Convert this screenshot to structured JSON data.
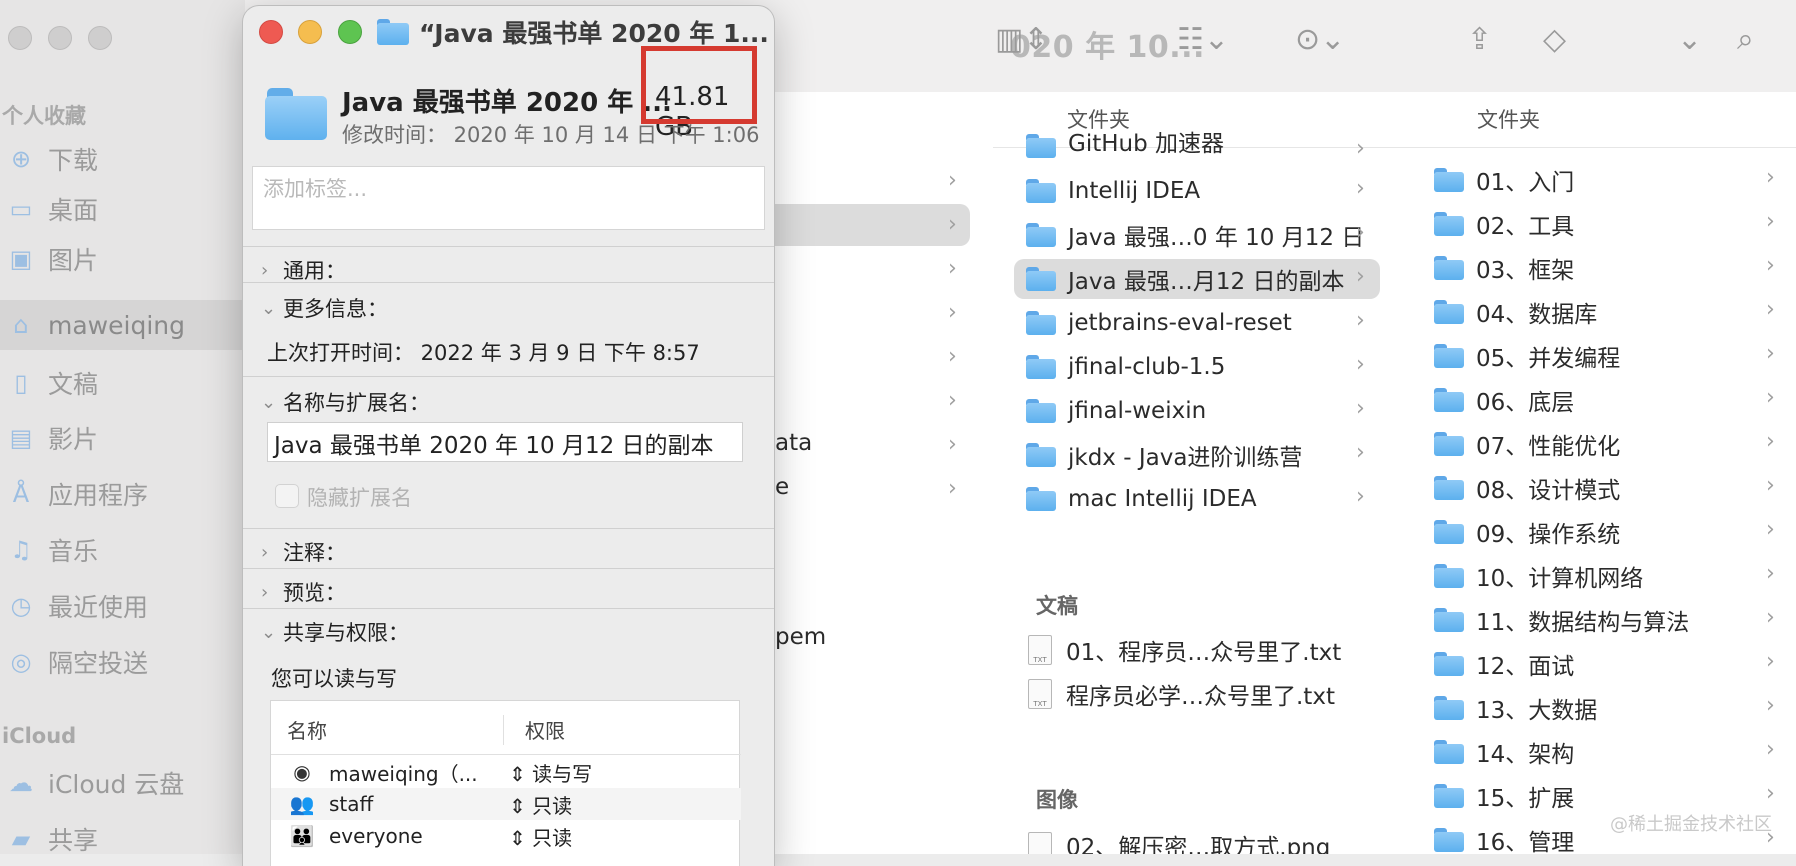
{
  "finder": {
    "window_title": "020 年 10...",
    "sidebar": {
      "favorites_label": "个人收藏",
      "items": [
        {
          "label": "下载",
          "icon": "download-icon"
        },
        {
          "label": "桌面",
          "icon": "desktop-icon"
        },
        {
          "label": "图片",
          "icon": "pictures-icon"
        },
        {
          "label": "maweiqing",
          "icon": "home-icon"
        },
        {
          "label": "文稿",
          "icon": "document-icon"
        },
        {
          "label": "影片",
          "icon": "film-icon"
        },
        {
          "label": "应用程序",
          "icon": "applications-icon"
        },
        {
          "label": "音乐",
          "icon": "music-icon"
        },
        {
          "label": "最近使用",
          "icon": "clock-icon"
        },
        {
          "label": "隔空投送",
          "icon": "airdrop-icon"
        }
      ],
      "icloud_label": "iCloud",
      "icloud_items": [
        {
          "label": "iCloud 云盘",
          "icon": "cloud-icon"
        },
        {
          "label": "共享",
          "icon": "shared-folder-icon"
        }
      ]
    },
    "column2_partial": [
      "ata",
      "e",
      "pem"
    ],
    "column3": {
      "header": "文件夹",
      "folders": [
        "GitHub 加速器",
        "Intellij IDEA",
        "Java 最强…0 年 10 月12 日",
        "Java 最强…月12 日的副本",
        "jetbrains-eval-reset",
        "jfinal-club-1.5",
        "jfinal-weixin",
        "jkdx - Java进阶训练营",
        "mac Intellij IDEA"
      ],
      "documents_label": "文稿",
      "documents": [
        "01、程序员…众号里了.txt",
        "程序员必学…众号里了.txt"
      ],
      "images_label": "图像",
      "images": [
        "02、解压密…取方式.png"
      ]
    },
    "column4": {
      "header": "文件夹",
      "folders": [
        "01、入门",
        "02、工具",
        "03、框架",
        "04、数据库",
        "05、并发编程",
        "06、底层",
        "07、性能优化",
        "08、设计模式",
        "09、操作系统",
        "10、计算机网络",
        "11、数据结构与算法",
        "12、面试",
        "13、大数据",
        "14、架构",
        "15、扩展",
        "16、管理"
      ]
    },
    "watermark": "@稀土掘金技术社区"
  },
  "info": {
    "title": "“Java 最强书单 2020 年 1...",
    "name": "Java 最强书单 2020 年 ...",
    "size": "41.81 GB",
    "modified": "修改时间： 2020 年 10 月 14 日 下午 1:06",
    "tags_placeholder": "添加标签...",
    "sections": {
      "general": "通用：",
      "more_info": "更多信息：",
      "last_opened": "上次打开时间： 2022 年 3 月 9 日 下午 8:57",
      "name_ext": "名称与扩展名：",
      "name_value": "Java 最强书单 2020 年 10 月12 日的副本",
      "hide_ext": "隐藏扩展名",
      "comments": "注释：",
      "preview": "预览：",
      "sharing": "共享与权限：",
      "sharing_desc": "您可以读与写"
    },
    "perm_table": {
      "col_name": "名称",
      "col_perm": "权限",
      "rows": [
        {
          "user": "maweiqing（...",
          "perm": "读与写",
          "icon": "user-icon"
        },
        {
          "user": "staff",
          "perm": "只读",
          "icon": "group-icon"
        },
        {
          "user": "everyone",
          "perm": "只读",
          "icon": "everyone-icon"
        }
      ]
    }
  },
  "colors": {
    "highlight_box": "#d53a30",
    "folder_blue": "#5cb0ee"
  }
}
